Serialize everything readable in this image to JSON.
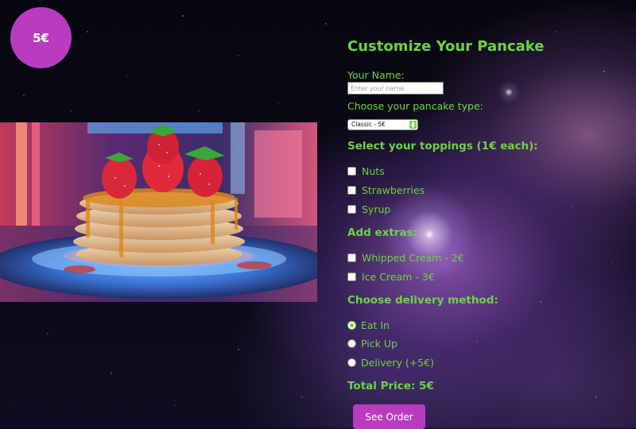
{
  "price_badge": "5€",
  "form": {
    "title": "Customize Your Pancake",
    "name_label": "Your Name:",
    "name_placeholder": "Enter your name",
    "name_value": "",
    "type_label": "Choose your pancake type:",
    "type_selected": "Classic - 5€",
    "toppings_label": "Select your toppings (1€ each):",
    "toppings": [
      {
        "label": "Nuts",
        "checked": false
      },
      {
        "label": "Strawberries",
        "checked": false
      },
      {
        "label": "Syrup",
        "checked": false
      }
    ],
    "extras_label": "Add extras:",
    "extras": [
      {
        "label": "Whipped Cream - 2€",
        "checked": false
      },
      {
        "label": "Ice Cream - 3€",
        "checked": false
      }
    ],
    "delivery_label": "Choose delivery method:",
    "delivery": [
      {
        "label": "Eat In",
        "selected": true
      },
      {
        "label": "Pick Up",
        "selected": false
      },
      {
        "label": "Delivery (+5€)",
        "selected": false
      }
    ],
    "total_price": "Total Price: 5€",
    "order_button": "See Order"
  },
  "colors": {
    "accent_green": "#6dd440",
    "accent_magenta": "#b93cc0"
  }
}
